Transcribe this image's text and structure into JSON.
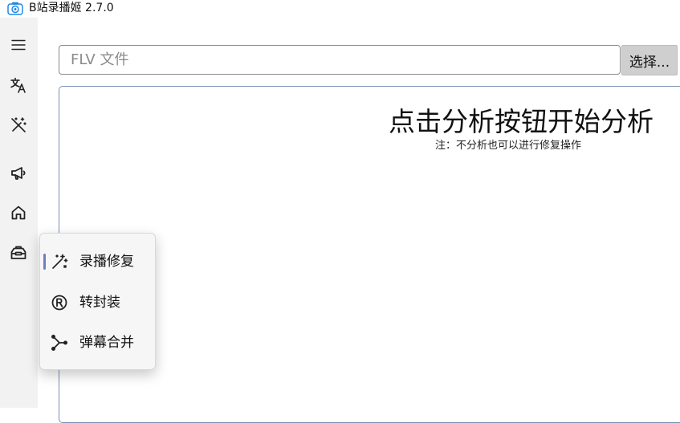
{
  "window": {
    "title": "B站录播姬 2.7.0",
    "app_icon": "camera-icon"
  },
  "rail": {
    "items": [
      {
        "icon": "hamburger-menu-icon"
      },
      {
        "icon": "translate-icon"
      },
      {
        "icon": "magic-wand-off-icon"
      },
      {
        "icon": "megaphone-icon"
      },
      {
        "icon": "home-icon"
      },
      {
        "icon": "toolbox-icon"
      }
    ]
  },
  "file_picker": {
    "placeholder": "FLV 文件",
    "button_label": "选择..."
  },
  "analysis": {
    "title": "点击分析按钮开始分析",
    "note": "注：不分析也可以进行修复操作"
  },
  "flyout": {
    "items": [
      {
        "label": "录播修复",
        "icon": "magic-wand-icon",
        "selected": true
      },
      {
        "label": "转封装",
        "icon": "registered-icon",
        "selected": false
      },
      {
        "label": "弹幕合并",
        "icon": "merge-icon",
        "selected": false
      }
    ]
  },
  "colors": {
    "selection_accent": "#6b7fc4",
    "panel_border": "#7b8fb3",
    "rail_bg": "#f2f2f2"
  }
}
